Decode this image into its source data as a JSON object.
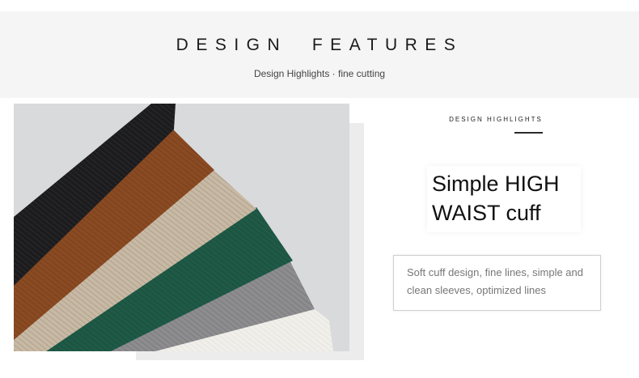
{
  "header": {
    "title": "DESIGN  FEATURES",
    "subtitle": "Design Highlights · fine cutting"
  },
  "feature": {
    "label": "DESIGN HIGHLIGHTS",
    "title_line1": "Simple HIGH",
    "title_line2": "WAIST cuff",
    "description": "Soft cuff design, fine lines, simple and clean sleeves, optimized lines"
  },
  "swatches": [
    {
      "name": "black-cuff",
      "color": "#1c1c1e"
    },
    {
      "name": "brown-cuff",
      "color": "#8a4a22"
    },
    {
      "name": "beige-cuff",
      "color": "#c8b9a4"
    },
    {
      "name": "green-cuff",
      "color": "#1f5a46"
    },
    {
      "name": "gray-cuff",
      "color": "#8d8d8f"
    },
    {
      "name": "white-cuff",
      "color": "#f1efea"
    }
  ],
  "colors": {
    "background_band": "#f5f5f5",
    "photo_background": "#d9dadc"
  }
}
